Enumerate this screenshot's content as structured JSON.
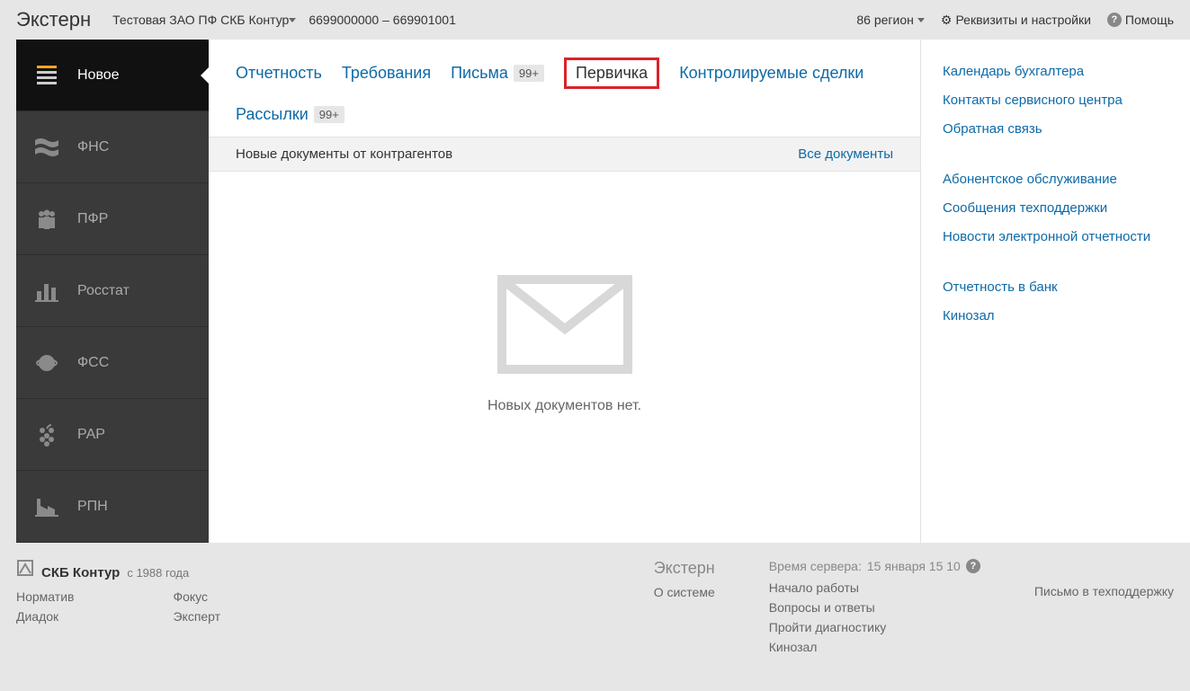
{
  "topbar": {
    "logo": "Экстерн",
    "org": "Тестовая ЗАО ПФ СКБ Контур",
    "inn": "6699000000 – 669901001",
    "region": "86 регион",
    "settings": "Реквизиты и настройки",
    "help": "Помощь"
  },
  "sidebar": {
    "items": [
      {
        "label": "Новое"
      },
      {
        "label": "ФНС"
      },
      {
        "label": "ПФР"
      },
      {
        "label": "Росстат"
      },
      {
        "label": "ФСС"
      },
      {
        "label": "РАР"
      },
      {
        "label": "РПН"
      }
    ]
  },
  "tabs": {
    "reporting": "Отчетность",
    "requests": "Требования",
    "letters": "Письма",
    "letters_badge": "99+",
    "primary": "Первичка",
    "controlled": "Контролируемые сделки",
    "mailings": "Рассылки",
    "mailings_badge": "99+"
  },
  "subheader": {
    "title": "Новые документы от контрагентов",
    "link": "Все документы"
  },
  "empty": {
    "text": "Новых документов нет."
  },
  "rightlinks": {
    "g1": [
      "Календарь бухгалтера",
      "Контакты сервисного центра",
      "Обратная связь"
    ],
    "g2": [
      "Абонентское обслуживание",
      "Сообщения техподдержки",
      "Новости электронной отчетности"
    ],
    "g3": [
      "Отчетность в банк",
      "Кинозал"
    ]
  },
  "footer": {
    "brand": "СКБ Контур",
    "since": "с 1988 года",
    "col1": [
      "Норматив",
      "Диадок"
    ],
    "col2": [
      "Фокус",
      "Эксперт"
    ],
    "extern": "Экстерн",
    "about": "О системе",
    "server_prefix": "Время сервера: ",
    "server_value": "15 января 15 10",
    "helpcol": [
      "Начало работы",
      "Вопросы и ответы",
      "Пройти диагностику",
      "Кинозал"
    ],
    "support": "Письмо в техподдержку"
  }
}
